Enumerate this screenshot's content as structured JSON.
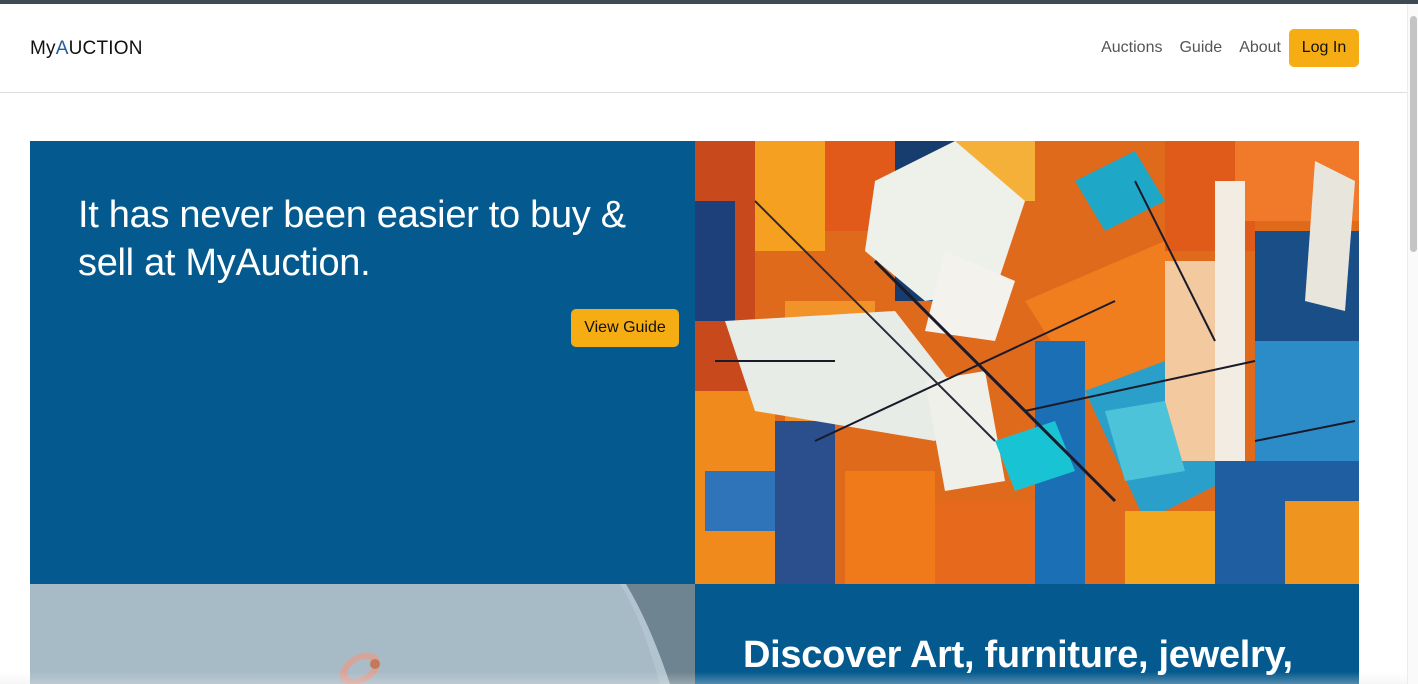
{
  "brand": {
    "prefix": "My",
    "accent_letter": "A",
    "suffix": "UCTION"
  },
  "nav": {
    "links": [
      "Auctions",
      "Guide",
      "About"
    ],
    "login_label": "Log In"
  },
  "hero": {
    "headline": "It has never been easier to buy & sell at MyAuction.",
    "guide_button": "View Guide"
  },
  "discover": {
    "headline": "Discover Art, furniture, jewelry,"
  },
  "colors": {
    "primary_blue": "#045a8f",
    "accent_yellow": "#f6ad14",
    "brand_accent": "#1f5f9c"
  }
}
